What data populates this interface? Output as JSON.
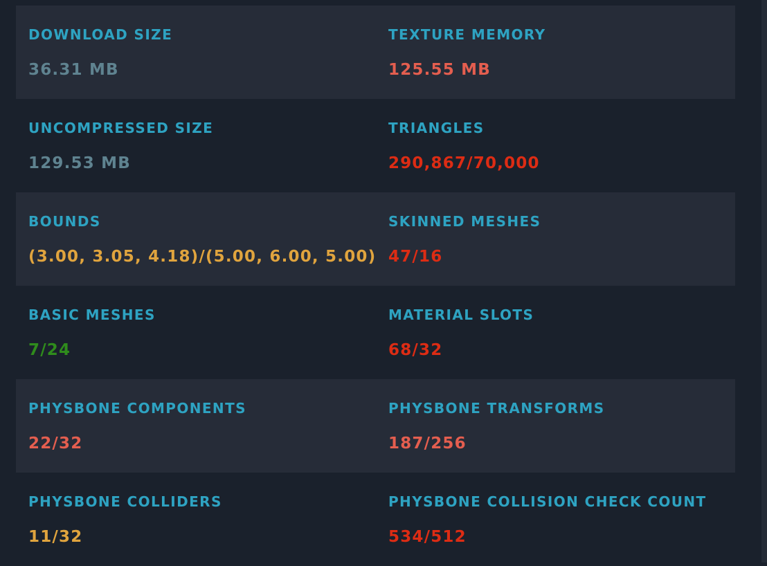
{
  "colors": {
    "label": "#2ea3c2",
    "neutral": "#5f8390",
    "warn": "#e0a43e",
    "poor": "#e45e4f",
    "very_poor": "#dd2c14",
    "good": "#2f8c1c"
  },
  "stats": [
    {
      "label": "DOWNLOAD SIZE",
      "value": "36.31 MB",
      "status": "neutral"
    },
    {
      "label": "TEXTURE MEMORY",
      "value": "125.55 MB",
      "status": "poor"
    },
    {
      "label": "UNCOMPRESSED SIZE",
      "value": "129.53 MB",
      "status": "neutral"
    },
    {
      "label": "TRIANGLES",
      "value": "290,867/70,000",
      "status": "very_poor"
    },
    {
      "label": "BOUNDS",
      "value": "(3.00, 3.05, 4.18)/(5.00, 6.00, 5.00)",
      "status": "warn"
    },
    {
      "label": "SKINNED MESHES",
      "value": "47/16",
      "status": "very_poor"
    },
    {
      "label": "BASIC MESHES",
      "value": "7/24",
      "status": "good"
    },
    {
      "label": "MATERIAL SLOTS",
      "value": "68/32",
      "status": "very_poor"
    },
    {
      "label": "PHYSBONE COMPONENTS",
      "value": "22/32",
      "status": "poor"
    },
    {
      "label": "PHYSBONE TRANSFORMS",
      "value": "187/256",
      "status": "poor"
    },
    {
      "label": "PHYSBONE COLLIDERS",
      "value": "11/32",
      "status": "warn"
    },
    {
      "label": "PHYSBONE COLLISION CHECK COUNT",
      "value": "534/512",
      "status": "very_poor"
    }
  ]
}
